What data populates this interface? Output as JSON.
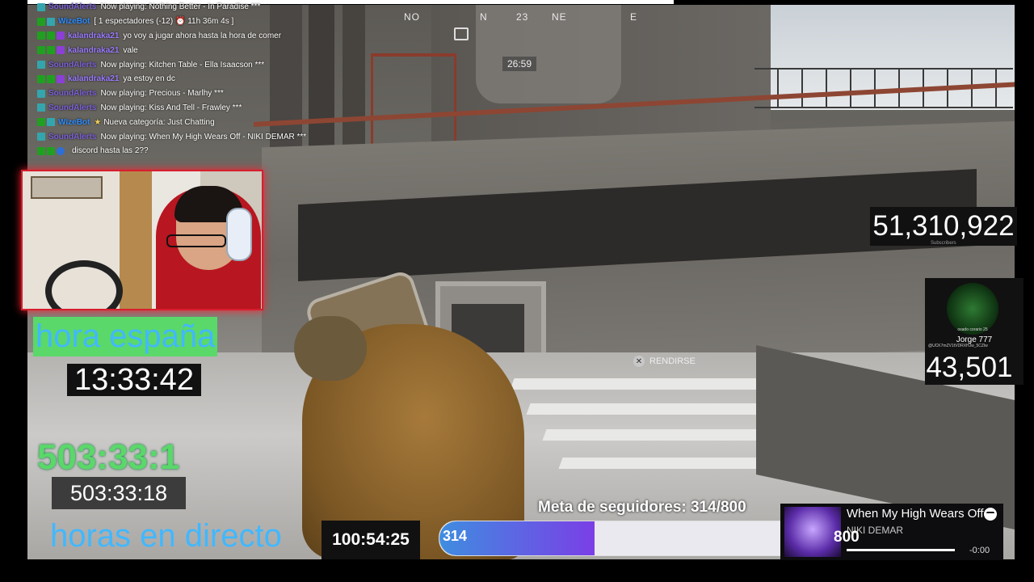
{
  "chat": {
    "messages": [
      {
        "user": "SoundAlerts",
        "text": "Now playing: Nothing Better - In Paradise ***",
        "badges": [
          "teal"
        ],
        "user_class": "u-sound"
      },
      {
        "user": "WizeBot",
        "text": "[ 1 espectadores (-12) ⏰ 11h 36m 4s ]",
        "badges": [
          "green",
          "teal"
        ],
        "user_class": "u-wize"
      },
      {
        "user": "kalandraka21",
        "text": "yo voy a jugar ahora hasta la hora de comer",
        "badges": [
          "green",
          "green",
          "purple"
        ],
        "user_class": "u-kala"
      },
      {
        "user": "kalandraka21",
        "text": "vale",
        "badges": [
          "green",
          "green",
          "purple"
        ],
        "user_class": "u-kala"
      },
      {
        "user": "SoundAlerts",
        "text": "Now playing: Kitchen Table - Ella Isaacson ***",
        "badges": [
          "teal"
        ],
        "user_class": "u-sound"
      },
      {
        "user": "kalandraka21",
        "text": "ya estoy en dc",
        "badges": [
          "green",
          "green",
          "purple"
        ],
        "user_class": "u-kala"
      },
      {
        "user": "SoundAlerts",
        "text": "Now playing: Precious - Marlhy ***",
        "badges": [
          "teal"
        ],
        "user_class": "u-sound"
      },
      {
        "user": "SoundAlerts",
        "text": "Now playing: Kiss And Tell - Frawley ***",
        "badges": [
          "teal"
        ],
        "user_class": "u-sound"
      },
      {
        "user": "WizeBot",
        "text": "Nueva categoría: Just Chatting",
        "badges": [
          "green",
          "teal"
        ],
        "user_class": "u-wize",
        "star": true
      },
      {
        "user": "SoundAlerts",
        "text": "Now playing: When My High Wears Off - NIKI DEMAR ***",
        "badges": [
          "teal"
        ],
        "user_class": "u-sound"
      },
      {
        "user": "",
        "text": "discord hasta las 2??",
        "badges": [
          "green",
          "green",
          "blue"
        ],
        "user_class": "u-hidden"
      }
    ]
  },
  "hud": {
    "compass": [
      "NO",
      "N",
      "23",
      "NE",
      "E"
    ],
    "game_time": "26:59",
    "surrender_label": "RENDIRSE",
    "surrender_button": "✕"
  },
  "overlay": {
    "hora_label": "hora españa",
    "clock": "13:33:42",
    "big_counter": "503:33:1",
    "small_counter": "503:33:18",
    "horas_label": "horas en directo",
    "uptime": "100:54:25"
  },
  "goal": {
    "title": "Meta de seguidores: 314/800",
    "current": "314",
    "max": "800",
    "progress": 0.3925
  },
  "spotify": {
    "song": "When My High Wears Off",
    "artist": "NIKI DEMAR",
    "time_left": "-0:00"
  },
  "right": {
    "subscribers": "51,310,922",
    "subscribers_label": "Subscribers",
    "avatar_text": "osado corario 25",
    "profile_name": "Jorge 777",
    "profile_id": "@UCK7mZV1tVDRXHJw_5CZlw",
    "profile_count": "43,501"
  },
  "colors": {
    "green": "#5ad86a",
    "blue": "#41b8ff",
    "cam_border": "#d61f2e",
    "goal_start": "#3f8de0",
    "goal_end": "#7a3fe6"
  }
}
